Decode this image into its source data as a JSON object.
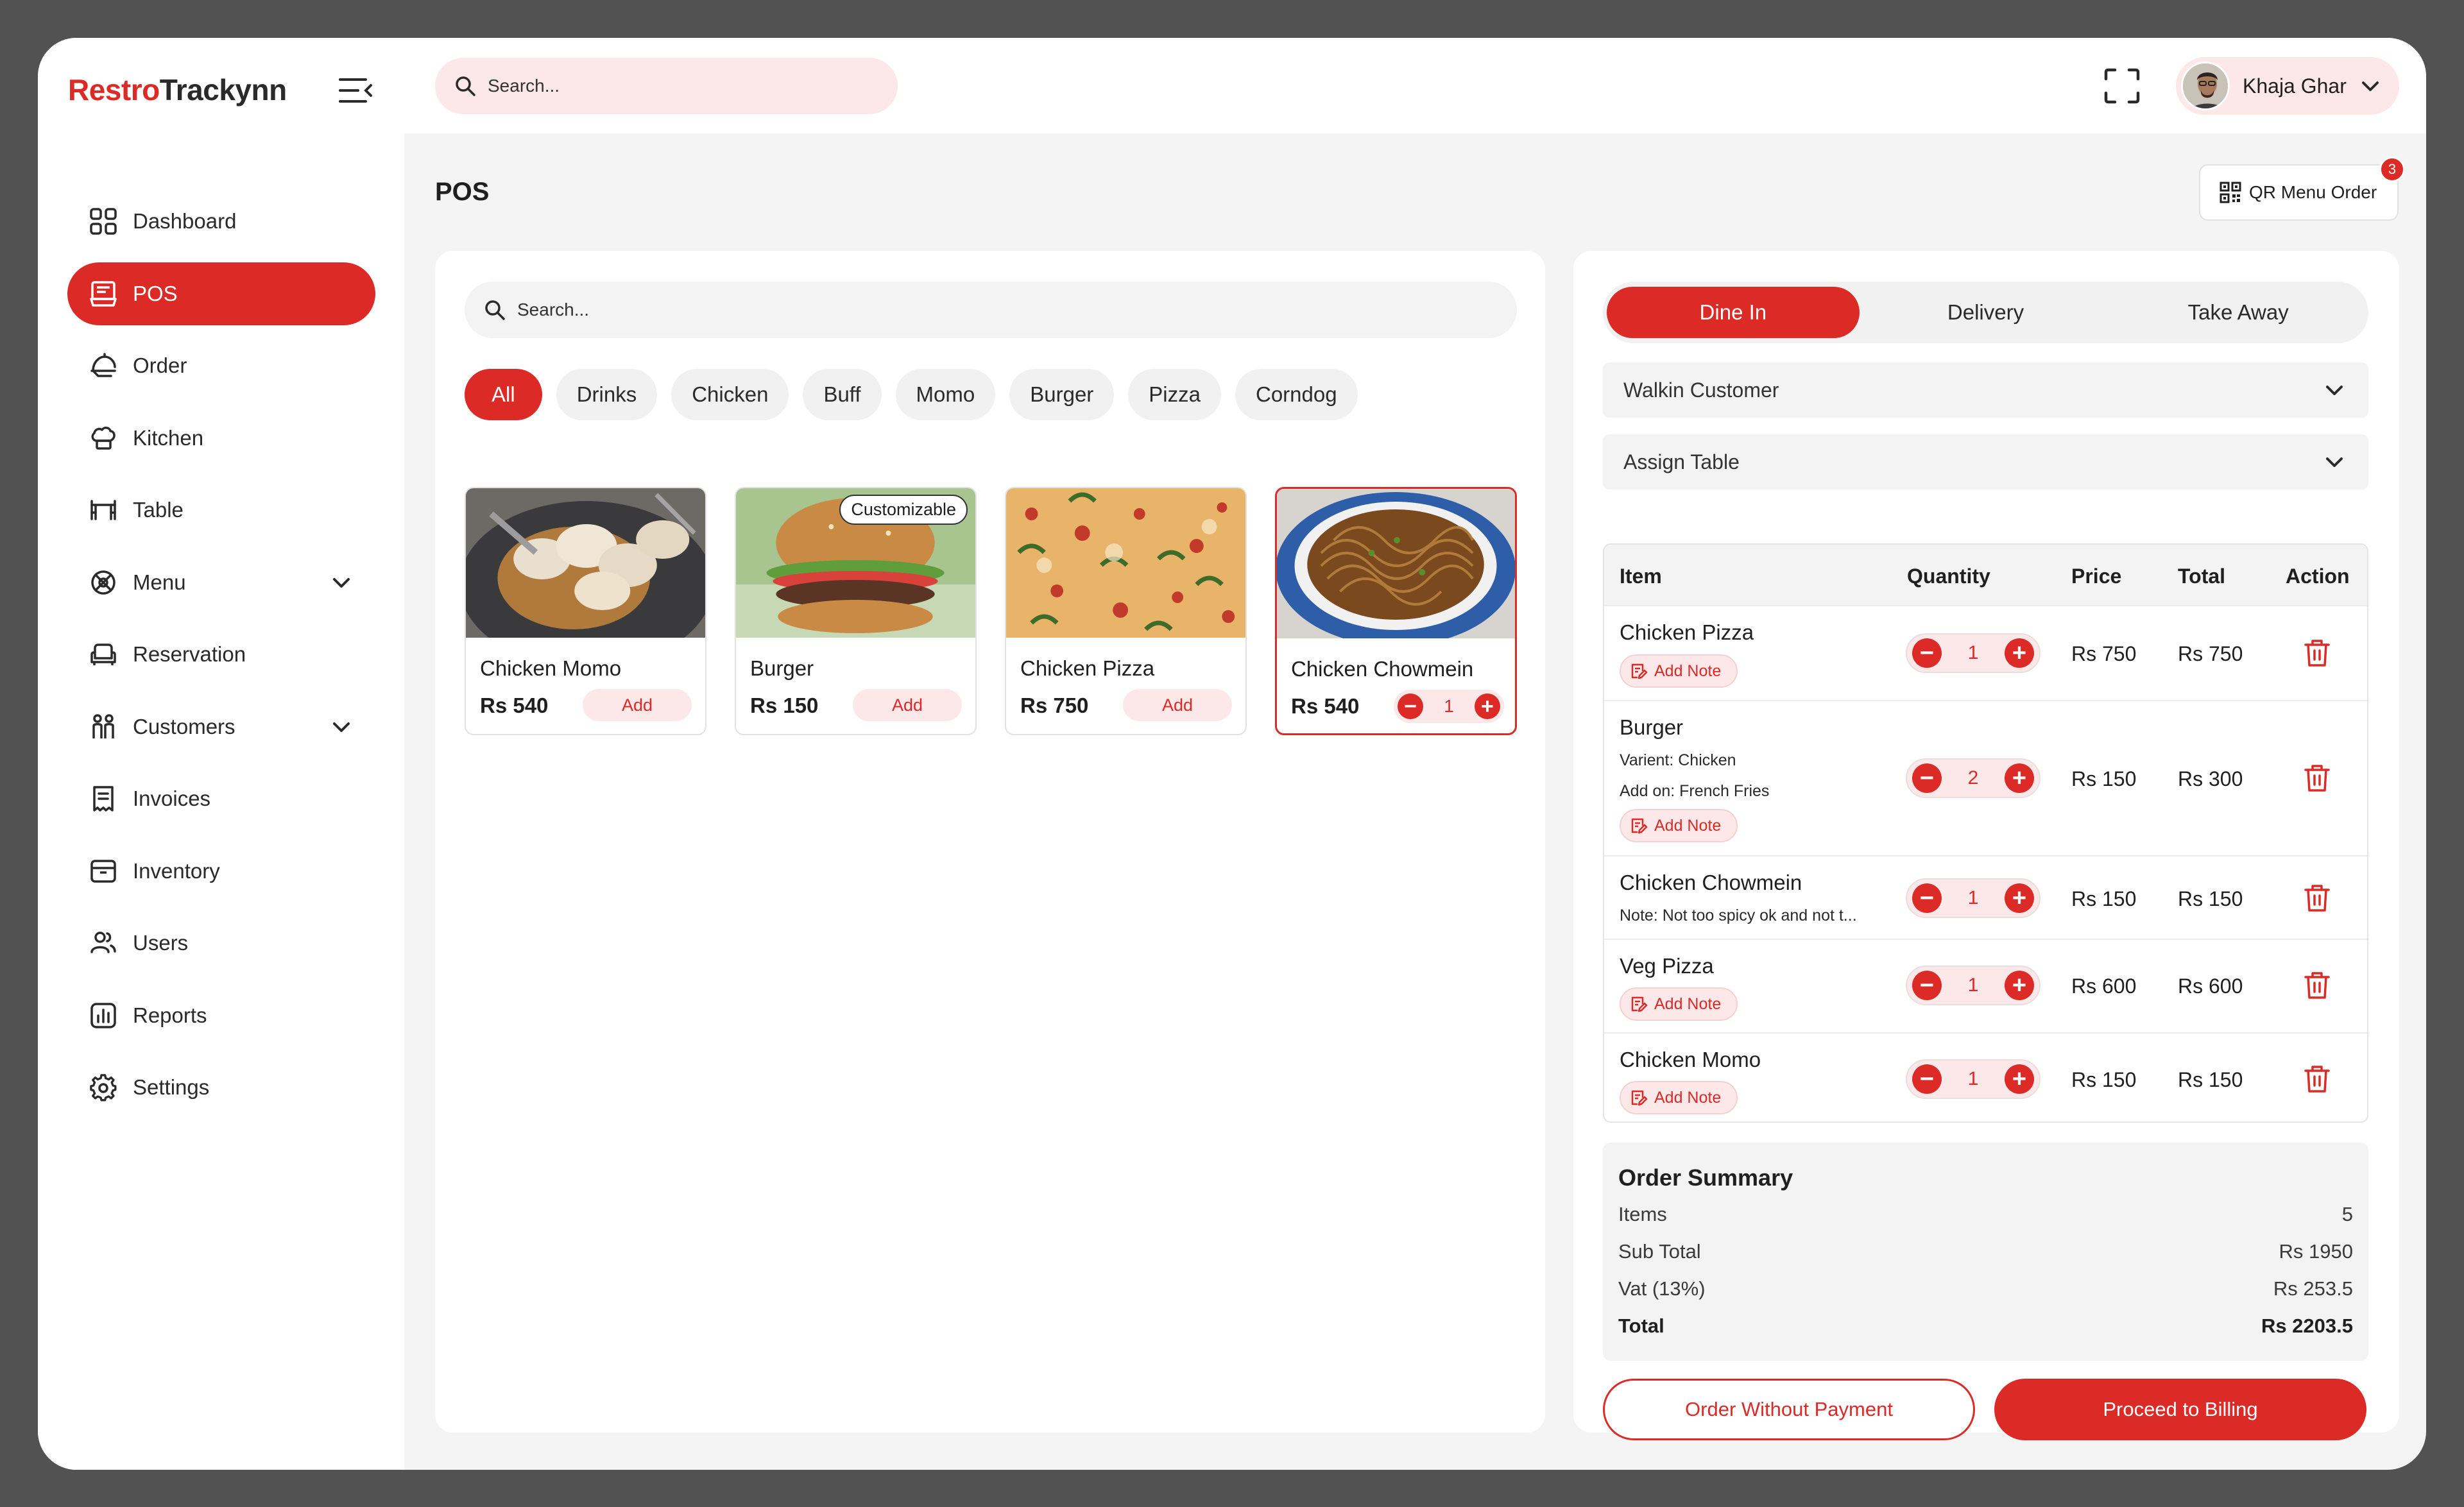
{
  "brand": {
    "part1": "Restro",
    "part2": "Trackynn"
  },
  "colors": {
    "accent": "#dc2a26",
    "accent_soft": "#fce8e8",
    "background": "#f4f4f4"
  },
  "top_search": {
    "placeholder": "Search..."
  },
  "user": {
    "name": "Khaja Ghar"
  },
  "sidebar": {
    "items": [
      {
        "label": "Dashboard",
        "icon": "dashboard-icon",
        "active": false
      },
      {
        "label": "POS",
        "icon": "pos-icon",
        "active": true
      },
      {
        "label": "Order",
        "icon": "order-icon",
        "active": false
      },
      {
        "label": "Kitchen",
        "icon": "chef-hat-icon",
        "active": false
      },
      {
        "label": "Table",
        "icon": "table-icon",
        "active": false
      },
      {
        "label": "Menu",
        "icon": "menu-icon",
        "active": false,
        "expandable": true
      },
      {
        "label": "Reservation",
        "icon": "sofa-icon",
        "active": false
      },
      {
        "label": "Customers",
        "icon": "customers-icon",
        "active": false,
        "expandable": true
      },
      {
        "label": "Invoices",
        "icon": "invoice-icon",
        "active": false
      },
      {
        "label": "Inventory",
        "icon": "inventory-icon",
        "active": false
      },
      {
        "label": "Users",
        "icon": "users-icon",
        "active": false
      },
      {
        "label": "Reports",
        "icon": "reports-icon",
        "active": false
      },
      {
        "label": "Settings",
        "icon": "settings-icon",
        "active": false
      }
    ]
  },
  "page": {
    "title": "POS"
  },
  "qr_button": {
    "label": "QR Menu Order",
    "badge": "3"
  },
  "products": {
    "search_placeholder": "Search...",
    "categories": [
      "All",
      "Drinks",
      "Chicken",
      "Buff",
      "Momo",
      "Burger",
      "Pizza",
      "Corndog"
    ],
    "active_category": "All",
    "items": [
      {
        "name": "Chicken Momo",
        "price": "Rs 540",
        "action": "Add"
      },
      {
        "name": "Burger",
        "price": "Rs 150",
        "action": "Add",
        "badge": "Customizable"
      },
      {
        "name": "Chicken Pizza",
        "price": "Rs 750",
        "action": "Add"
      },
      {
        "name": "Chicken Chowmein",
        "price": "Rs 540",
        "quantity": "1"
      }
    ]
  },
  "order": {
    "tabs": [
      "Dine In",
      "Delivery",
      "Take Away"
    ],
    "active_tab": "Dine In",
    "customer": "Walkin Customer",
    "table": "Assign Table",
    "columns": [
      "Item",
      "Quantity",
      "Price",
      "Total",
      "Action"
    ],
    "note_label": "Add Note",
    "rows": [
      {
        "name": "Chicken Pizza",
        "quantity": "1",
        "price": "Rs 750",
        "total": "Rs 750"
      },
      {
        "name": "Burger",
        "variant": "Varient: Chicken",
        "addon": "Add on: French Fries",
        "quantity": "2",
        "price": "Rs 150",
        "total": "Rs 300"
      },
      {
        "name": "Chicken Chowmein",
        "note": "Note: Not too spicy ok and not t...",
        "quantity": "1",
        "price": "Rs 150",
        "total": "Rs 150"
      },
      {
        "name": "Veg Pizza",
        "quantity": "1",
        "price": "Rs 600",
        "total": "Rs 600"
      },
      {
        "name": "Chicken Momo",
        "quantity": "1",
        "price": "Rs 150",
        "total": "Rs 150"
      }
    ]
  },
  "summary": {
    "title": "Order Summary",
    "items_label": "Items",
    "items_value": "5",
    "subtotal_label": "Sub Total",
    "subtotal_value": "Rs 1950",
    "vat_label": "Vat (13%)",
    "vat_value": "Rs 253.5",
    "total_label": "Total",
    "total_value": "Rs 2203.5"
  },
  "actions": {
    "secondary": "Order Without Payment",
    "primary": "Proceed to Billing"
  }
}
